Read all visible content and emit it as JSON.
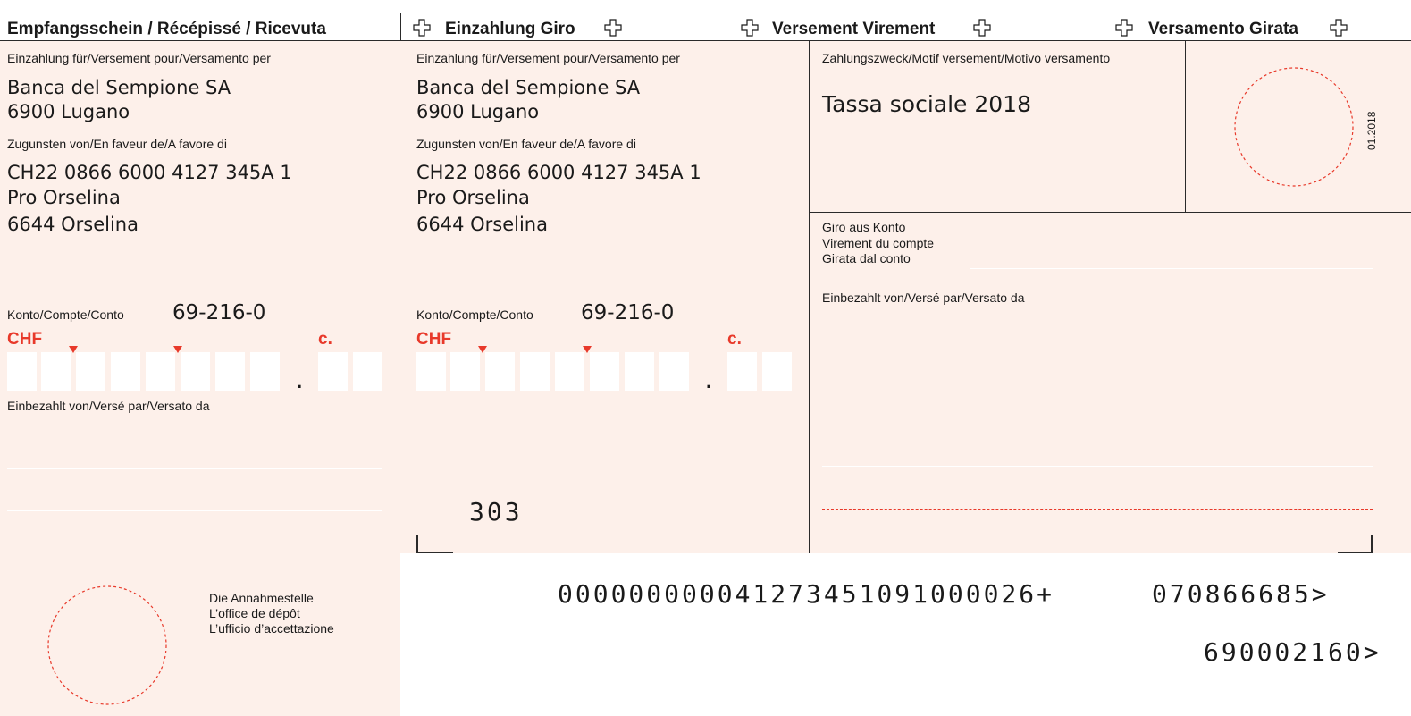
{
  "header": {
    "receipt_title": "Empfangsschein / Récépissé / Ricevuta",
    "giro_title": "Einzahlung Giro",
    "virement_title": "Versement Virement",
    "girata_title": "Versamento Girata"
  },
  "receipt": {
    "payment_for_label": "Einzahlung für/Versement pour/Versamento per",
    "bank_line1": "Banca del Sempione SA",
    "bank_line2": "6900 Lugano",
    "in_favour_label": "Zugunsten von/En faveur de/A favore di",
    "iban": "CH22 0866 6000 4127 345A 1",
    "beneficiary_line1": "Pro Orselina",
    "beneficiary_line2": "6644 Orselina",
    "account_label": "Konto/Compte/Conto",
    "account_number": "69-216-0",
    "currency": "CHF",
    "cents_label": "c.",
    "decimal_dot": ".",
    "paid_by_label": "Einbezahlt von/Versé par/Versato da",
    "acceptance_line1": "Die Annahmestelle",
    "acceptance_line2": "L’office de dépôt",
    "acceptance_line3": "L’ufficio d’accettazione"
  },
  "slip": {
    "payment_for_label": "Einzahlung für/Versement pour/Versamento per",
    "bank_line1": "Banca del Sempione SA",
    "bank_line2": "6900 Lugano",
    "in_favour_label": "Zugunsten von/En faveur de/A favore di",
    "iban": "CH22 0866 6000 4127 345A 1",
    "beneficiary_line1": "Pro Orselina",
    "beneficiary_line2": "6644 Orselina",
    "account_label": "Konto/Compte/Conto",
    "account_number": "69-216-0",
    "currency": "CHF",
    "cents_label": "c.",
    "decimal_dot": ".",
    "form_code": "303"
  },
  "purpose": {
    "label": "Zahlungszweck/Motif versement/Motivo versamento",
    "value": "Tassa sociale 2018",
    "form_date": "01.2018"
  },
  "giro_account": {
    "line1": "Giro aus Konto",
    "line2": "Virement du compte",
    "line3": "Girata dal conto"
  },
  "paid_by": {
    "label": "Einbezahlt von/Versé par/Versato da"
  },
  "coding_line": {
    "reference": "000000000041273451091000026+",
    "clearing": "070866685>",
    "account": "690002160>"
  },
  "colors": {
    "background": "#fdf0ea",
    "accent_red": "#e8392a",
    "line": "#2a2a2a"
  }
}
